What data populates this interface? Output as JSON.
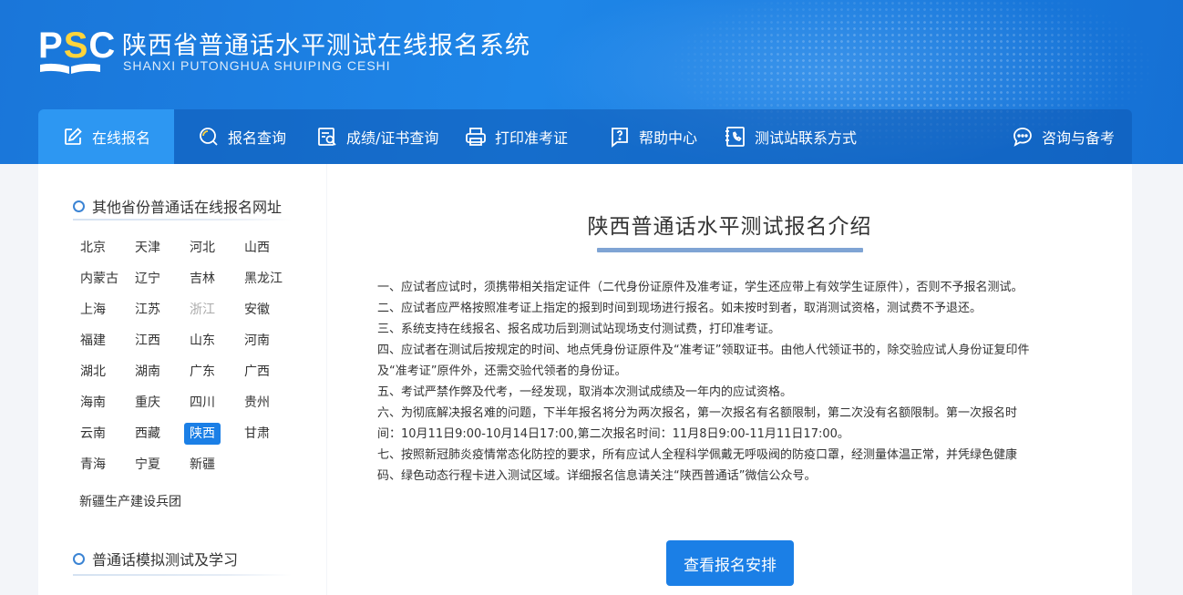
{
  "header": {
    "logo_text_p": "P",
    "logo_text_s": "S",
    "logo_text_c": "C",
    "title": "陕西省普通话水平测试在线报名系统",
    "subtitle": "SHANXI PUTONGHUA SHUIPING CESHI"
  },
  "nav": {
    "items": [
      {
        "label": "在线报名",
        "icon": "edit-icon",
        "active": true
      },
      {
        "label": "报名查询",
        "icon": "search-icon"
      },
      {
        "label": "成绩/证书查询",
        "icon": "certificate-search-icon"
      },
      {
        "label": "打印准考证",
        "icon": "printer-icon"
      },
      {
        "label": "帮助中心",
        "icon": "help-icon"
      },
      {
        "label": "测试站联系方式",
        "icon": "phone-book-icon"
      },
      {
        "label": "咨询与备考",
        "icon": "chat-icon"
      }
    ]
  },
  "sidebar": {
    "provinces_title": "其他省份普通话在线报名网址",
    "provinces": [
      "北京",
      "天津",
      "河北",
      "山西",
      "内蒙古",
      "辽宁",
      "吉林",
      "黑龙江",
      "上海",
      "江苏",
      "浙江",
      "安徽",
      "福建",
      "江西",
      "山东",
      "河南",
      "湖北",
      "湖南",
      "广东",
      "广西",
      "海南",
      "重庆",
      "四川",
      "贵州",
      "云南",
      "西藏",
      "陕西",
      "甘肃",
      "青海",
      "宁夏",
      "新疆"
    ],
    "province_extra": "新疆生产建设兵团",
    "selected_province": "陕西",
    "disabled_province": "浙江",
    "practice_title": "普通话模拟测试及学习"
  },
  "content": {
    "title": "陕西普通话水平测试报名介绍",
    "rules": [
      "一、应试者应试时，须携带相关指定证件（二代身份证原件及准考证，学生还应带上有效学生证原件），否则不予报名测试。",
      "二、应试者应严格按照准考证上指定的报到时间到现场进行报名。如未按时到者，取消测试资格，测试费不予退还。",
      "三、系统支持在线报名、报名成功后到测试站现场支付测试费，打印准考证。",
      "四、应试者在测试后按规定的时间、地点凭身份证原件及“准考证”领取证书。由他人代领证书的，除交验应试人身份证复印件",
      "及“准考证”原件外，还需交验代领者的身份证。",
      "五、考试严禁作弊及代考，一经发现，取消本次测试成绩及一年内的应试资格。",
      "六、为彻底解决报名难的问题，下半年报名将分为两次报名，第一次报名有名额限制，第二次没有名额限制。第一次报名时",
      "间：10月11日9:00-10月14日17:00,第二次报名时间：11月8日9:00-11月11日17:00。",
      "七、按照新冠肺炎疫情常态化防控的要求，所有应试人全程科学佩戴无呼吸阀的防疫口罩，经测量体温正常，并凭绿色健康",
      "码、绿色动态行程卡进入测试区域。详细报名信息请关注“陕西普通话”微信公众号。"
    ],
    "button_label": "查看报名安排"
  },
  "colors": {
    "header_blue": "#1a76d9",
    "nav_active": "#2d97f2",
    "accent": "#1b7fe6",
    "logo_yellow": "#ffd43b"
  }
}
